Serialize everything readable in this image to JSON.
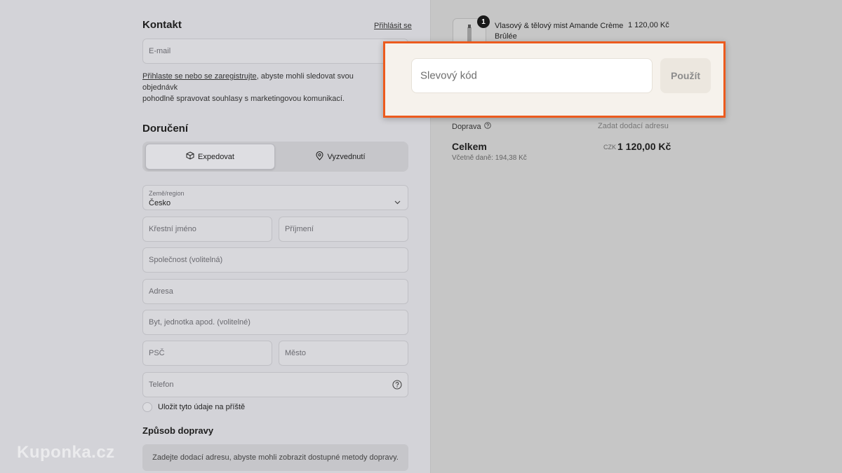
{
  "contact": {
    "heading": "Kontakt",
    "login_link": "Přihlásit se",
    "email_placeholder": "E-mail",
    "note_link": "Přihlaste se nebo se zaregistrujte",
    "note_line1_rest": ", abyste mohli sledovat svou objednávk",
    "note_line2": "pohodlně spravovat souhlasy s marketingovou komunikací."
  },
  "delivery": {
    "heading": "Doručení",
    "tab_ship": "Expedovat",
    "tab_pickup": "Vyzvednutí",
    "country_label": "Země/region",
    "country_value": "Česko",
    "first_name": "Křestní jméno",
    "last_name": "Příjmení",
    "company": "Společnost (volitelná)",
    "address": "Adresa",
    "apartment": "Byt, jednotka apod. (volitelné)",
    "postal_code": "PSČ",
    "city": "Město",
    "phone": "Telefon",
    "save_info": "Uložit tyto údaje na příště"
  },
  "shipping_method": {
    "heading": "Způsob dopravy",
    "note": "Zadejte dodací adresu, abyste mohli zobrazit dostupné metody dopravy."
  },
  "summary": {
    "quantity_badge": "1",
    "product_name": "Vlasový & tělový mist Amande Crème Brûlée",
    "product_price": "1 120,00 Kč",
    "shipping_label": "Doprava",
    "shipping_value": "Zadat dodací adresu",
    "total_label": "Celkem",
    "total_currency": "CZK",
    "total_value": "1 120,00 Kč",
    "tax_note": "Včetně daně: 194,38 Kč"
  },
  "discount": {
    "placeholder": "Slevový kód",
    "apply_label": "Použít"
  },
  "watermark": "Kuponka.cz",
  "colors": {
    "highlight_border": "#ec5b1e",
    "popup_background": "#f6f2ec"
  }
}
